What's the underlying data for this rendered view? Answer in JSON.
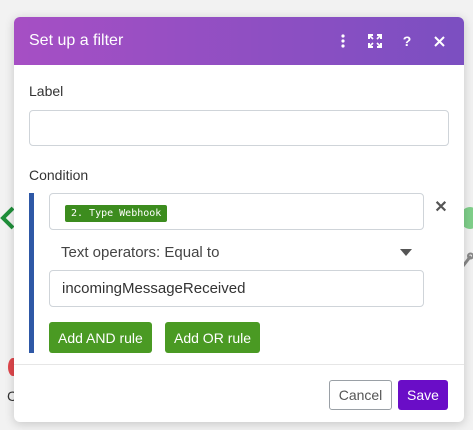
{
  "modal": {
    "title": "Set up a filter",
    "header_icons": [
      "more-vertical-icon",
      "fullscreen-icon",
      "help-icon",
      "close-icon"
    ]
  },
  "label_field": {
    "label": "Label",
    "value": ""
  },
  "condition": {
    "label": "Condition",
    "source_pill": "2. Type Webhook",
    "operator": "Text operators: Equal to",
    "value": "incomingMessageReceived",
    "add_and_label": "Add AND rule",
    "add_or_label": "Add OR rule"
  },
  "footer": {
    "cancel_label": "Cancel",
    "save_label": "Save"
  },
  "background": {
    "stray_text": "C"
  },
  "colors": {
    "header_start": "#a64fc4",
    "header_end": "#7b4fc1",
    "rule_green": "#4a9a23",
    "pill_green": "#3c8c1e",
    "save_purple": "#6a0dc7",
    "condition_bar": "#2e58a6"
  }
}
